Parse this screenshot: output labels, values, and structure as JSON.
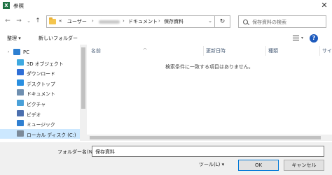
{
  "window": {
    "title": "参照",
    "close": "✕",
    "app_icon": "X"
  },
  "nav": {
    "back": "←",
    "forward": "→",
    "recent": "⌄",
    "up": "↑",
    "breadcrumb": [
      "«",
      "ユーザー",
      "ドキュメント",
      "保存資料"
    ],
    "refresh": "↻",
    "search_placeholder": "保存資料の検索"
  },
  "toolbar": {
    "organize": "整理 ▾",
    "new_folder": "新しいフォルダー"
  },
  "sidebar": {
    "items": [
      {
        "label": "PC",
        "icon": "pc-icon",
        "color": "#2d7fd1"
      },
      {
        "label": "3D オブジェクト",
        "icon": "cube-icon",
        "color": "#3fa9e0"
      },
      {
        "label": "ダウンロード",
        "icon": "download-icon",
        "color": "#2f6fd6"
      },
      {
        "label": "デスクトップ",
        "icon": "desktop-icon",
        "color": "#2a8fe0"
      },
      {
        "label": "ドキュメント",
        "icon": "document-icon",
        "color": "#6f8fb0"
      },
      {
        "label": "ピクチャ",
        "icon": "picture-icon",
        "color": "#4aa0d8"
      },
      {
        "label": "ビデオ",
        "icon": "video-icon",
        "color": "#4b6fae"
      },
      {
        "label": "ミュージック",
        "icon": "music-icon",
        "color": "#2f7fd1"
      },
      {
        "label": "ローカル ディスク (C:)",
        "icon": "disk-icon",
        "color": "#7c8a99"
      }
    ]
  },
  "columns": [
    "名前",
    "更新日時",
    "種類",
    "サイ"
  ],
  "empty_message": "検索条件に一致する項目はありません。",
  "footer": {
    "filename_label": "フォルダー名(N):",
    "filename_value": "保存資料",
    "tools": "ツール(L)  ▾",
    "ok": "OK",
    "cancel": "キャンセル"
  }
}
